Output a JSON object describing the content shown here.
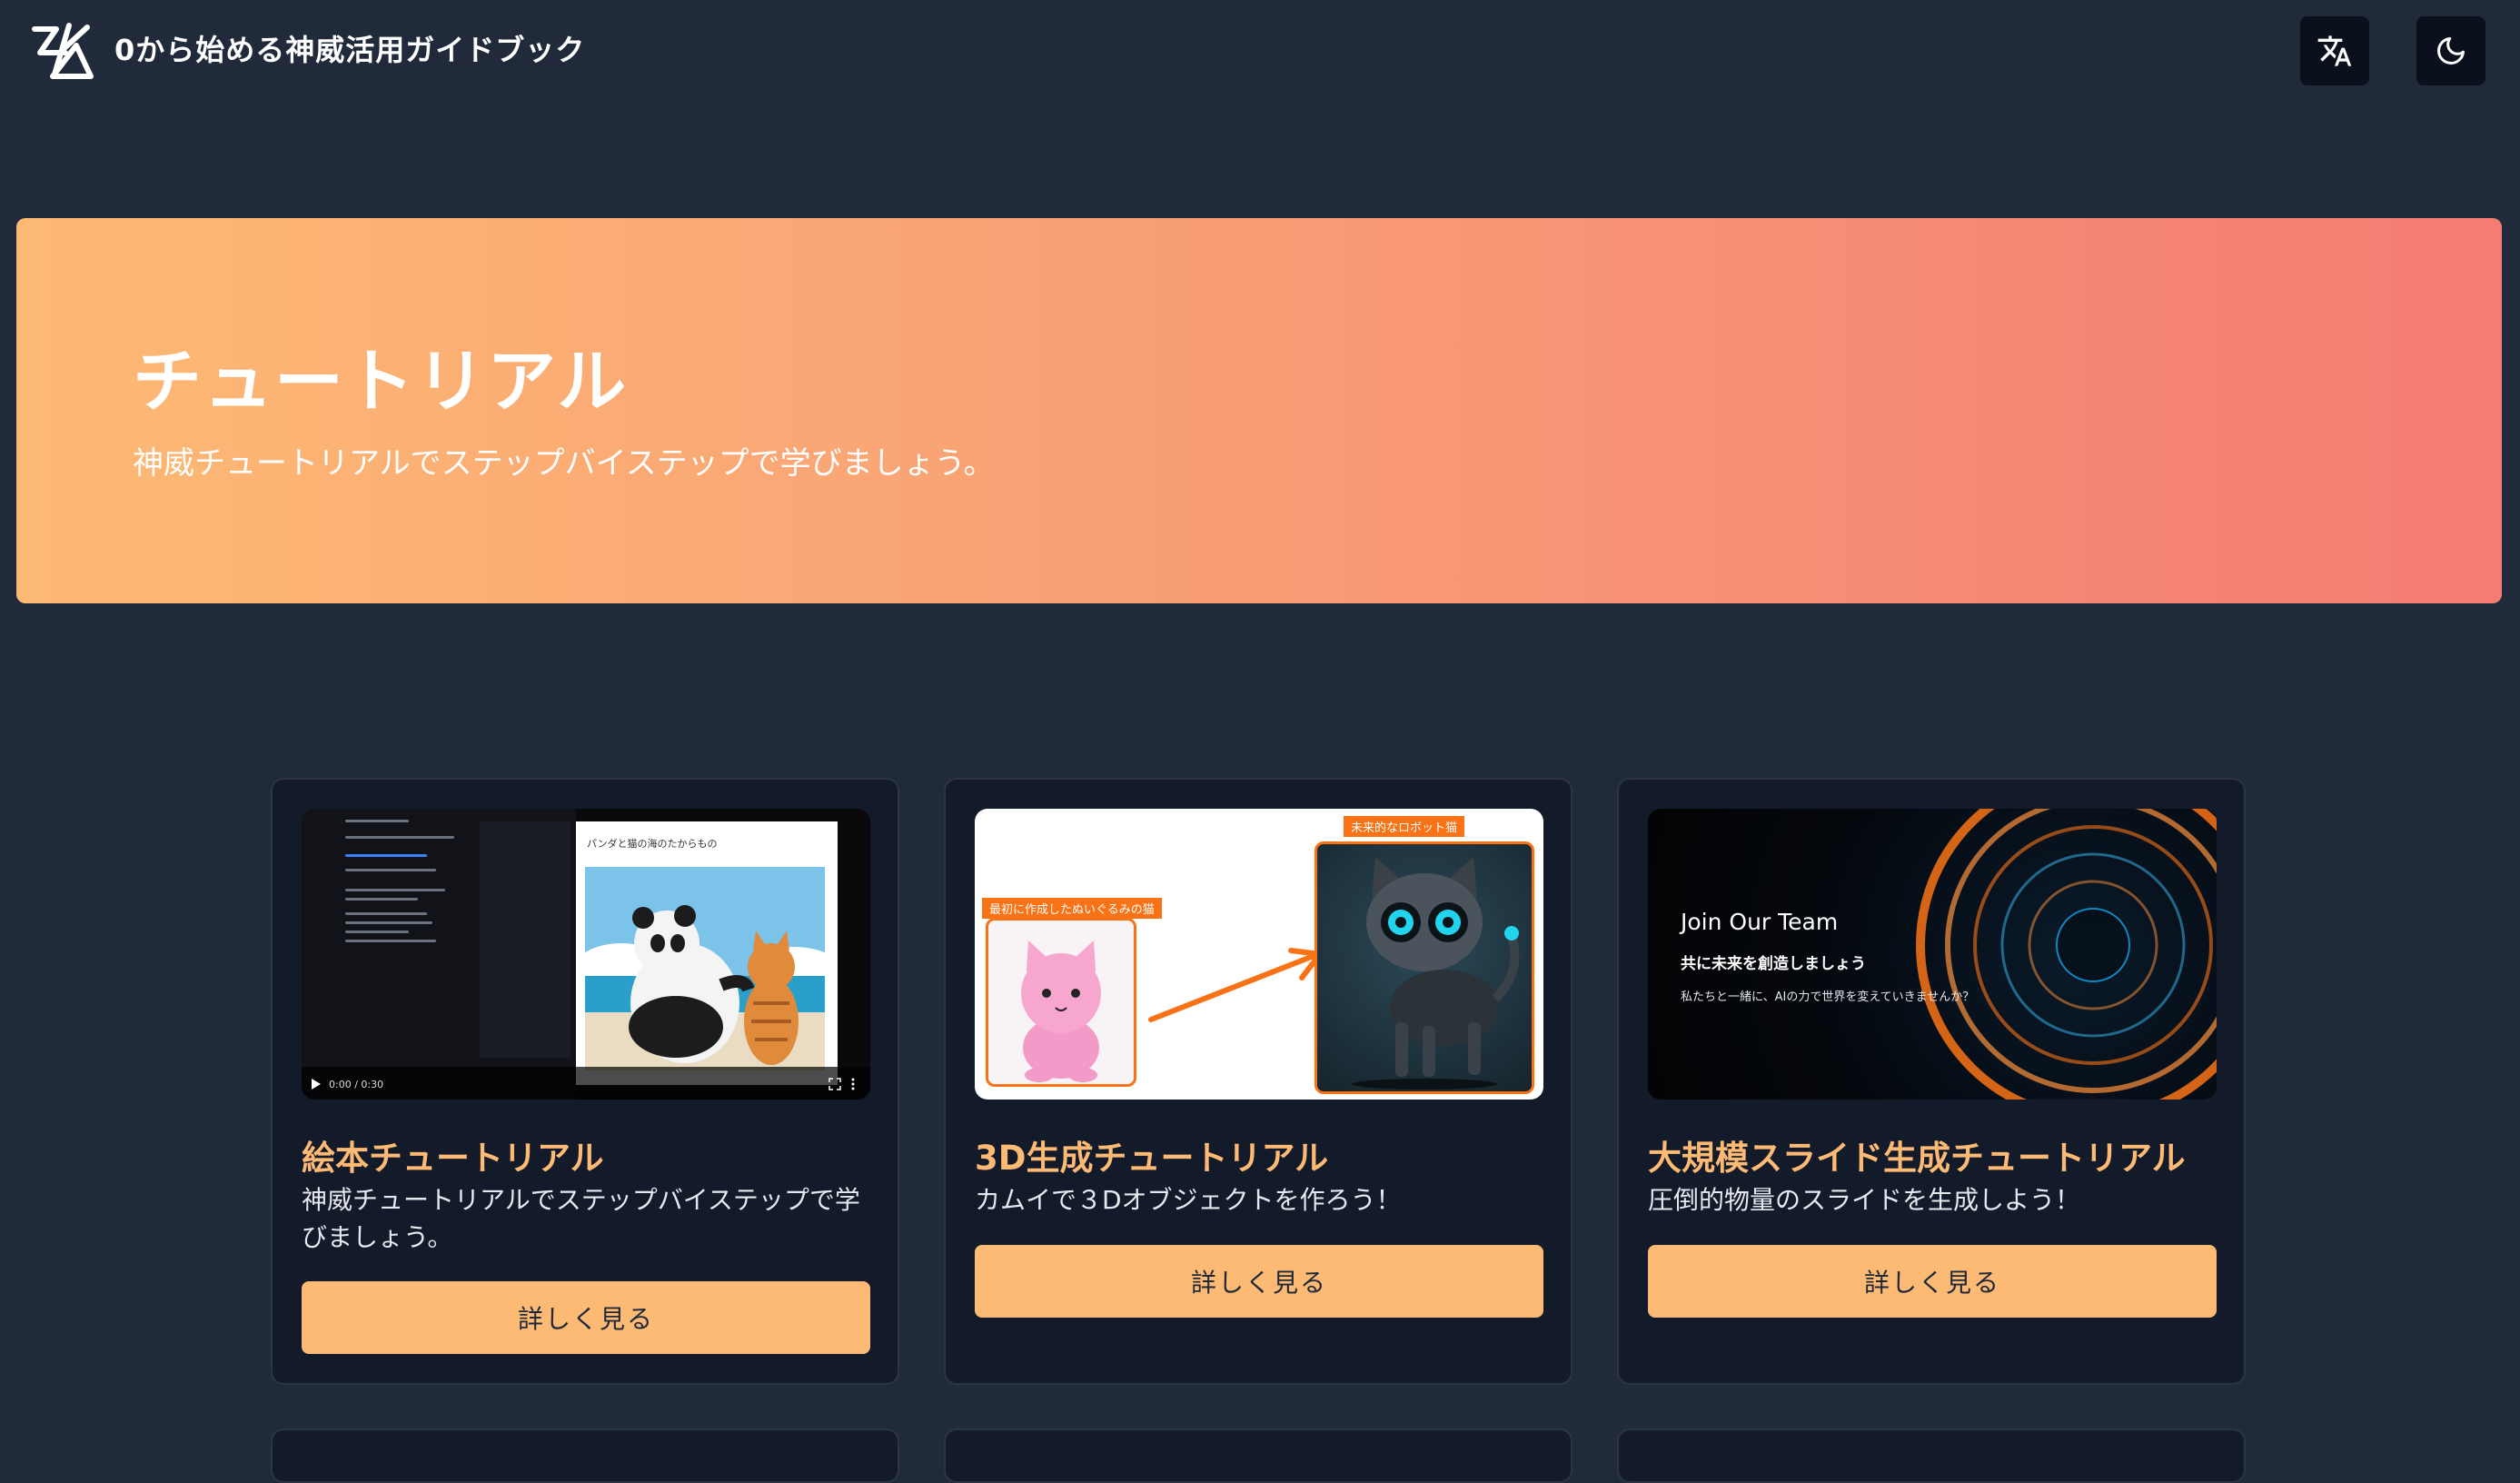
{
  "header": {
    "site_title": "0から始める神威活用ガイドブック",
    "translate_icon": "translate-icon",
    "theme_icon": "moon-icon"
  },
  "hero": {
    "title": "チュートリアル",
    "subtitle": "神威チュートリアルでステップバイステップで学びましょう。"
  },
  "cards": [
    {
      "title": "絵本チュートリアル",
      "description": "神威チュートリアルでステップバイステップで学びましょう。",
      "button_label": "詳しく見る",
      "thumbnail": {
        "page_title": "パンダと猫の海のたからもの",
        "video_time": "0:00 / 0:30"
      }
    },
    {
      "title": "3D生成チュートリアル",
      "description": "カムイで３Dオブジェクトを作ろう！",
      "button_label": "詳しく見る",
      "thumbnail": {
        "label_before": "最初に作成したぬいぐるみの猫",
        "label_after": "未来的なロボット猫"
      }
    },
    {
      "title": "大規模スライド生成チュートリアル",
      "description": "圧倒的物量のスライドを生成しよう！",
      "button_label": "詳しく見る",
      "thumbnail": {
        "heading": "Join Our Team",
        "subheading": "共に未来を創造しましょう",
        "body": "私たちと一緒に、AIの力で世界を変えていきませんか？"
      }
    }
  ],
  "colors": {
    "background": "#212a3a",
    "card": "#131a29",
    "accent": "#fdba74",
    "hero_start": "#fdba74",
    "hero_end": "#f47c74"
  }
}
